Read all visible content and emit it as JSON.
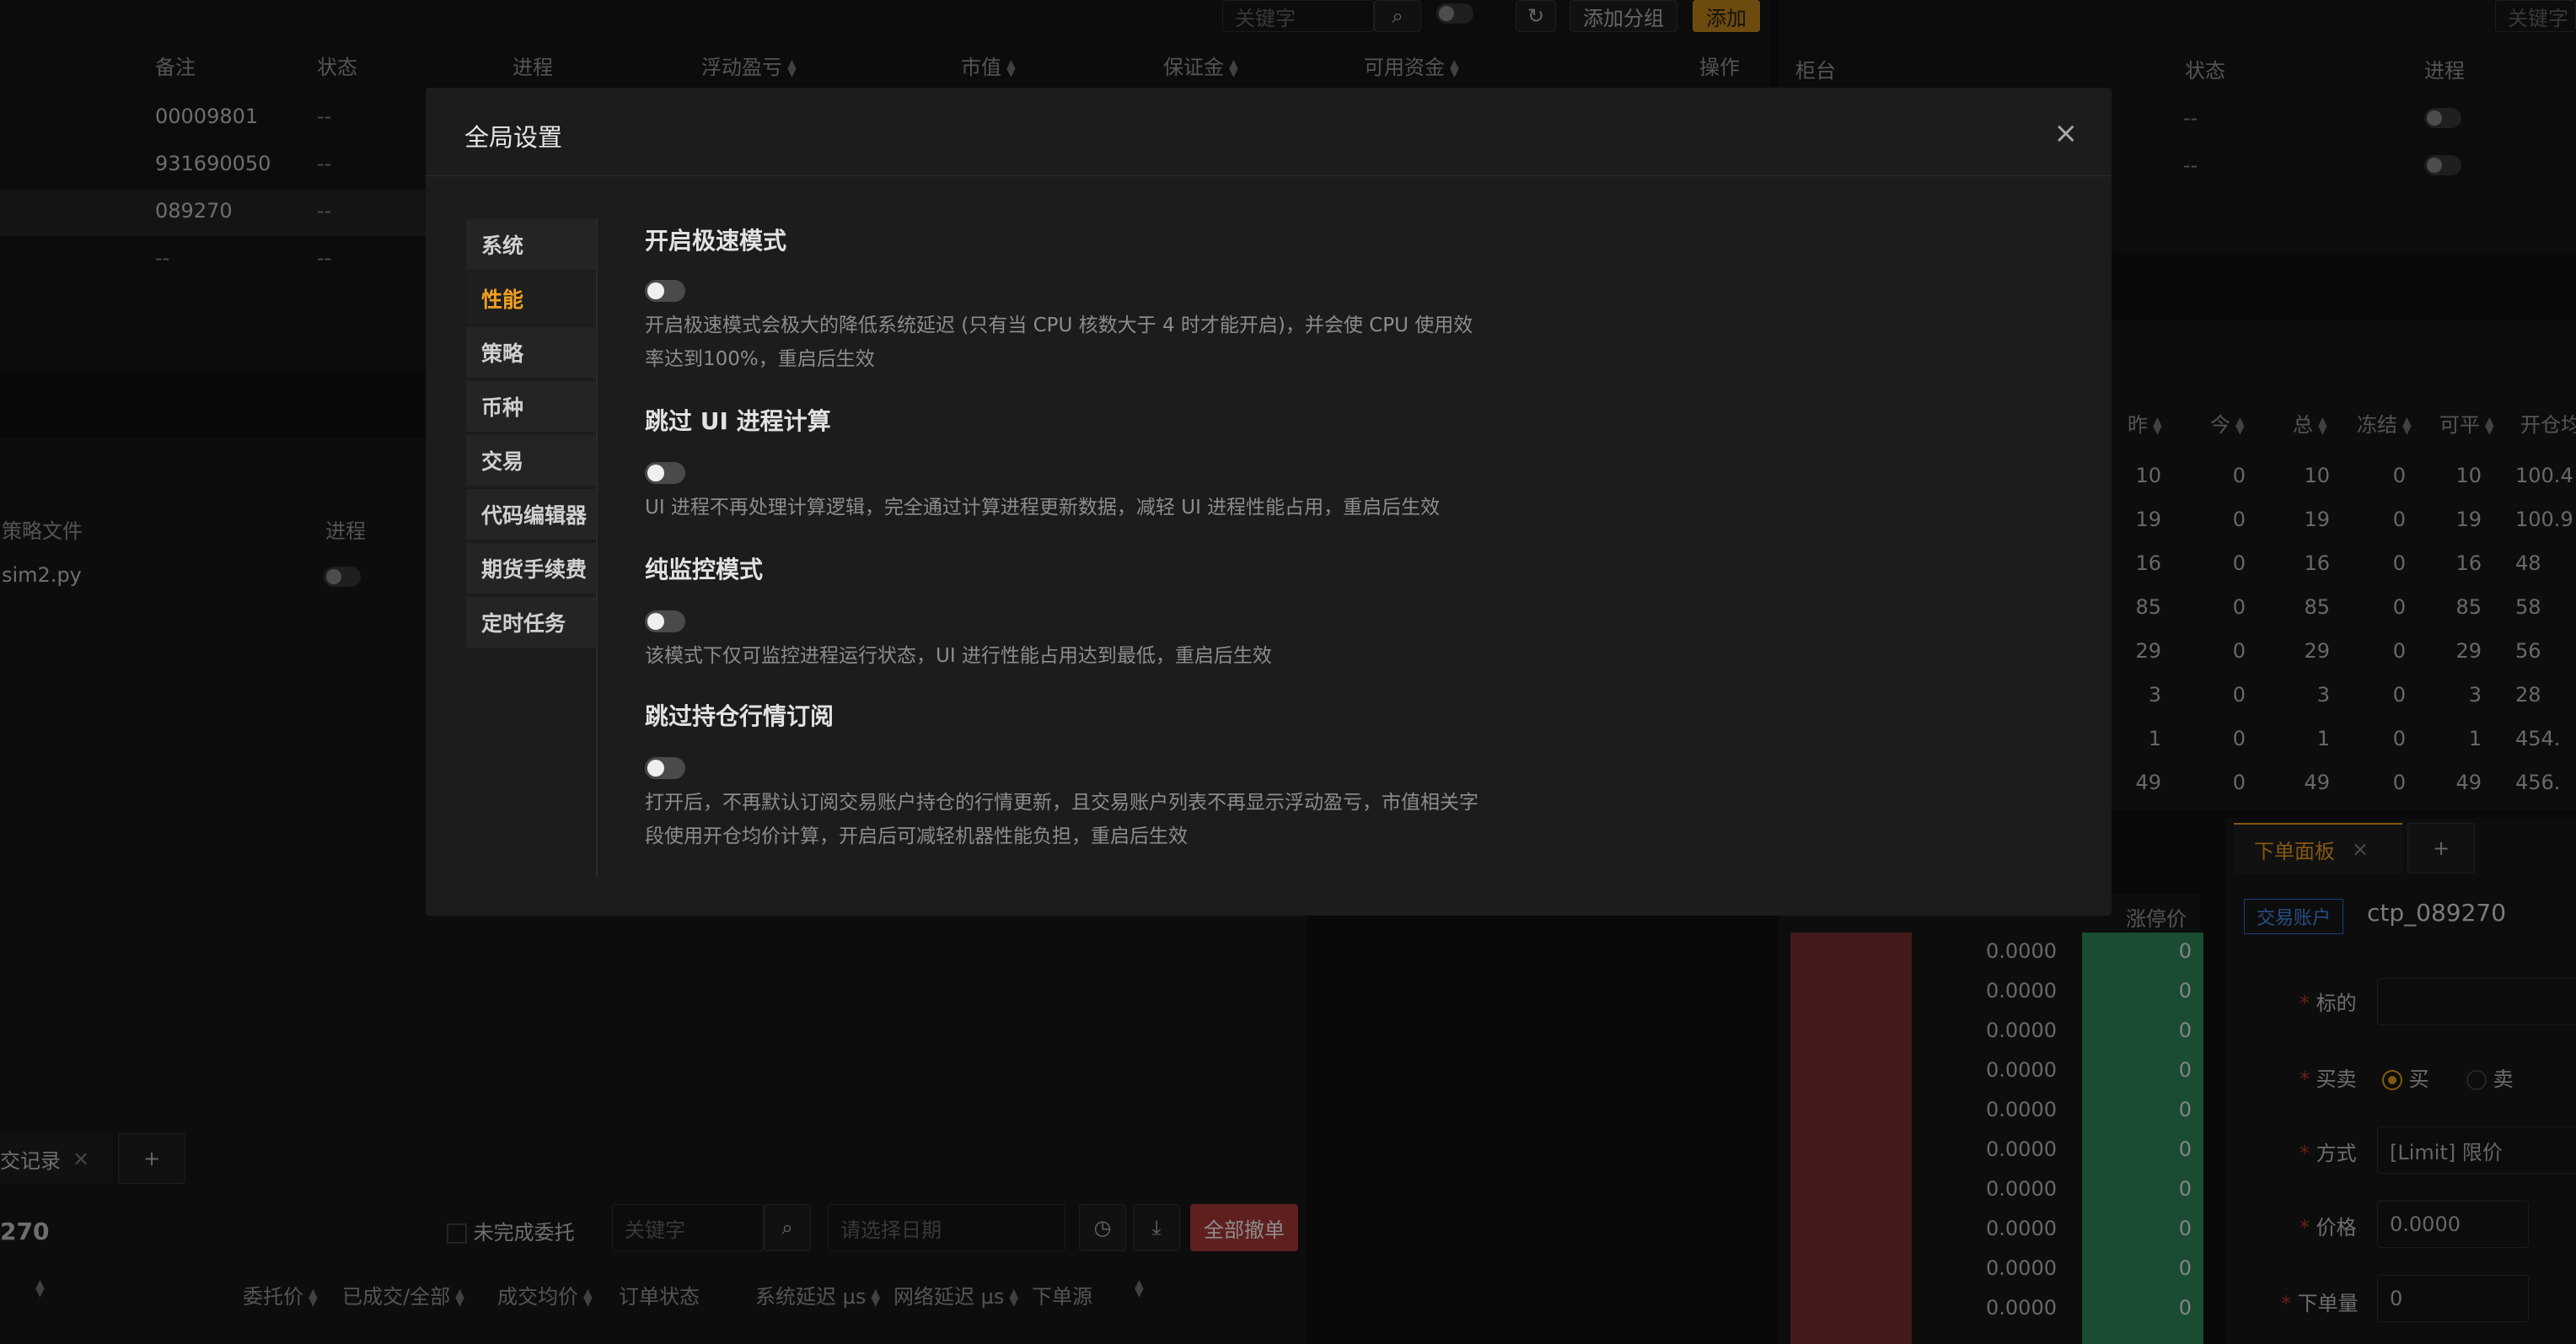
{
  "colors": {
    "accent": "#f0a020",
    "danger": "#c0392b",
    "buy_bar": "#7a2e2e",
    "sell_bar": "#2e8a5e",
    "blue_tag": "#2a6fdb"
  },
  "top_toolbar": {
    "search_placeholder": "关键字",
    "add_group_label": "添加分组",
    "add_label": "添加"
  },
  "accounts_table": {
    "headers": [
      "备注",
      "状态",
      "进程",
      "浮动盈亏",
      "市值",
      "保证金",
      "可用资金",
      "操作"
    ],
    "rows": [
      {
        "note": "00009801",
        "status": "--"
      },
      {
        "note": "931690050",
        "status": "--"
      },
      {
        "note": "089270",
        "status": "--"
      },
      {
        "note": "--",
        "status": "--"
      }
    ]
  },
  "counter_panel": {
    "search_placeholder": "关键字",
    "headers": [
      "柜台",
      "状态",
      "进程"
    ],
    "rows": [
      {
        "status": "--"
      },
      {
        "status": "--"
      }
    ]
  },
  "strategy_panel": {
    "headers": [
      "策略文件",
      "进程"
    ],
    "rows": [
      {
        "file": "sim2.py"
      }
    ]
  },
  "positions_table": {
    "headers": [
      "昨",
      "今",
      "总",
      "冻结",
      "可平",
      "开仓均"
    ],
    "rows": [
      [
        "10",
        "0",
        "10",
        "0",
        "10",
        "100.4"
      ],
      [
        "19",
        "0",
        "19",
        "0",
        "19",
        "100.9"
      ],
      [
        "16",
        "0",
        "16",
        "0",
        "16",
        "48"
      ],
      [
        "85",
        "0",
        "85",
        "0",
        "85",
        "58"
      ],
      [
        "29",
        "0",
        "29",
        "0",
        "29",
        "56"
      ],
      [
        "3",
        "0",
        "3",
        "0",
        "3",
        "28"
      ],
      [
        "1",
        "0",
        "1",
        "0",
        "1",
        "454."
      ],
      [
        "49",
        "0",
        "49",
        "0",
        "49",
        "456."
      ]
    ]
  },
  "depth_panel": {
    "header": "涨停价",
    "prices": [
      "0.0000",
      "0.0000",
      "0.0000",
      "0.0000",
      "0.0000",
      "0.0000",
      "0.0000",
      "0.0000",
      "0.0000",
      "0.0000"
    ],
    "volumes": [
      "0",
      "0",
      "0",
      "0",
      "0",
      "0",
      "0",
      "0",
      "0",
      "0"
    ]
  },
  "order_panel": {
    "tab_label": "下单面板",
    "account_tag": "交易账户",
    "account_name": "ctp_089270",
    "symbol_label": "标的",
    "side_label": "买卖",
    "buy_label": "买",
    "sell_label": "卖",
    "method_label": "方式",
    "method_value": "[Limit] 限价",
    "price_label": "价格",
    "price_value": "0.0000",
    "qty_label": "下单量",
    "qty_value": "0"
  },
  "orders_panel": {
    "tab_label": "交记录",
    "account_suffix": "270",
    "unfinished_label": "未完成委托",
    "search_placeholder": "关键字",
    "date_placeholder": "请选择日期",
    "cancel_all_label": "全部撤单",
    "headers": [
      "委托价",
      "已成交/全部",
      "成交均价",
      "订单状态",
      "系统延迟 μs",
      "网络延迟 μs",
      "下单源"
    ]
  },
  "modal": {
    "title": "全局设置",
    "nav": [
      "系统",
      "性能",
      "策略",
      "币种",
      "交易",
      "代码编辑器",
      "期货手续费",
      "定时任务"
    ],
    "active_index": 1,
    "options": [
      {
        "title": "开启极速模式",
        "desc": "开启极速模式会极大的降低系统延迟 (只有当 CPU 核数大于 4 时才能开启)，并会使 CPU 使用效率达到100%，重启后生效"
      },
      {
        "title": "跳过 UI 进程计算",
        "desc": "UI 进程不再处理计算逻辑，完全通过计算进程更新数据，减轻 UI 进程性能占用，重启后生效"
      },
      {
        "title": "纯监控模式",
        "desc": "该模式下仅可监控进程运行状态，UI 进行性能占用达到最低，重启后生效"
      },
      {
        "title": "跳过持仓行情订阅",
        "desc": "打开后，不再默认订阅交易账户持仓的行情更新，且交易账户列表不再显示浮动盈亏，市值相关字段使用开仓均价计算，开启后可减轻机器性能负担，重启后生效"
      }
    ]
  }
}
